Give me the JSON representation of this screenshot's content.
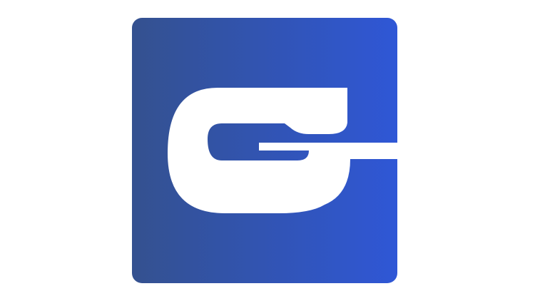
{
  "logo": {
    "name": "G app icon",
    "icon": "letter-g-logo-icon",
    "colors": {
      "gradient_start": "#34518f",
      "gradient_end": "#2f57d6",
      "glyph": "#ffffff",
      "background": "#ffffff"
    }
  }
}
